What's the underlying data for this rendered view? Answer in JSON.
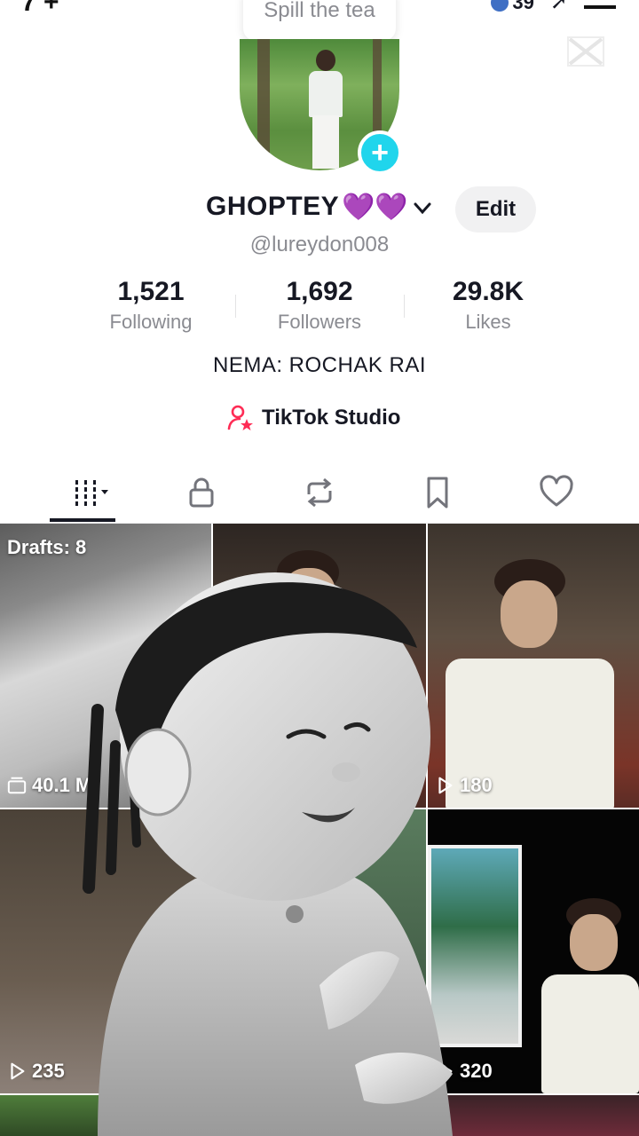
{
  "tooltip": {
    "text": "Spill the tea"
  },
  "status": {
    "left": "7 +",
    "count": "39"
  },
  "profile": {
    "username": "GHOPTEY",
    "hearts": "💜💜",
    "handle": "@lureydon008",
    "edit_label": "Edit",
    "bio": "NEMA: ROCHAK RAI",
    "studio_label": "TikTok Studio"
  },
  "stats": [
    {
      "value": "1,521",
      "label": "Following"
    },
    {
      "value": "1,692",
      "label": "Followers"
    },
    {
      "value": "29.8K",
      "label": "Likes"
    }
  ],
  "tabs": [
    "videos-tab",
    "private-tab",
    "reposts-tab",
    "favorites-tab",
    "liked-tab"
  ],
  "grid": {
    "drafts": "Drafts: 8",
    "items": [
      {
        "views": "40.1 M",
        "icon": "gallery-icon"
      },
      {
        "views": "",
        "icon": ""
      },
      {
        "views": "180",
        "icon": "play-icon"
      },
      {
        "views": "235",
        "icon": "play-icon"
      },
      {
        "views": "",
        "icon": ""
      },
      {
        "views": "320",
        "icon": "play-icon"
      }
    ]
  },
  "colors": {
    "accent": "#20d5ec",
    "studio": "#fe2c55",
    "heart": "#8e3ad6"
  }
}
